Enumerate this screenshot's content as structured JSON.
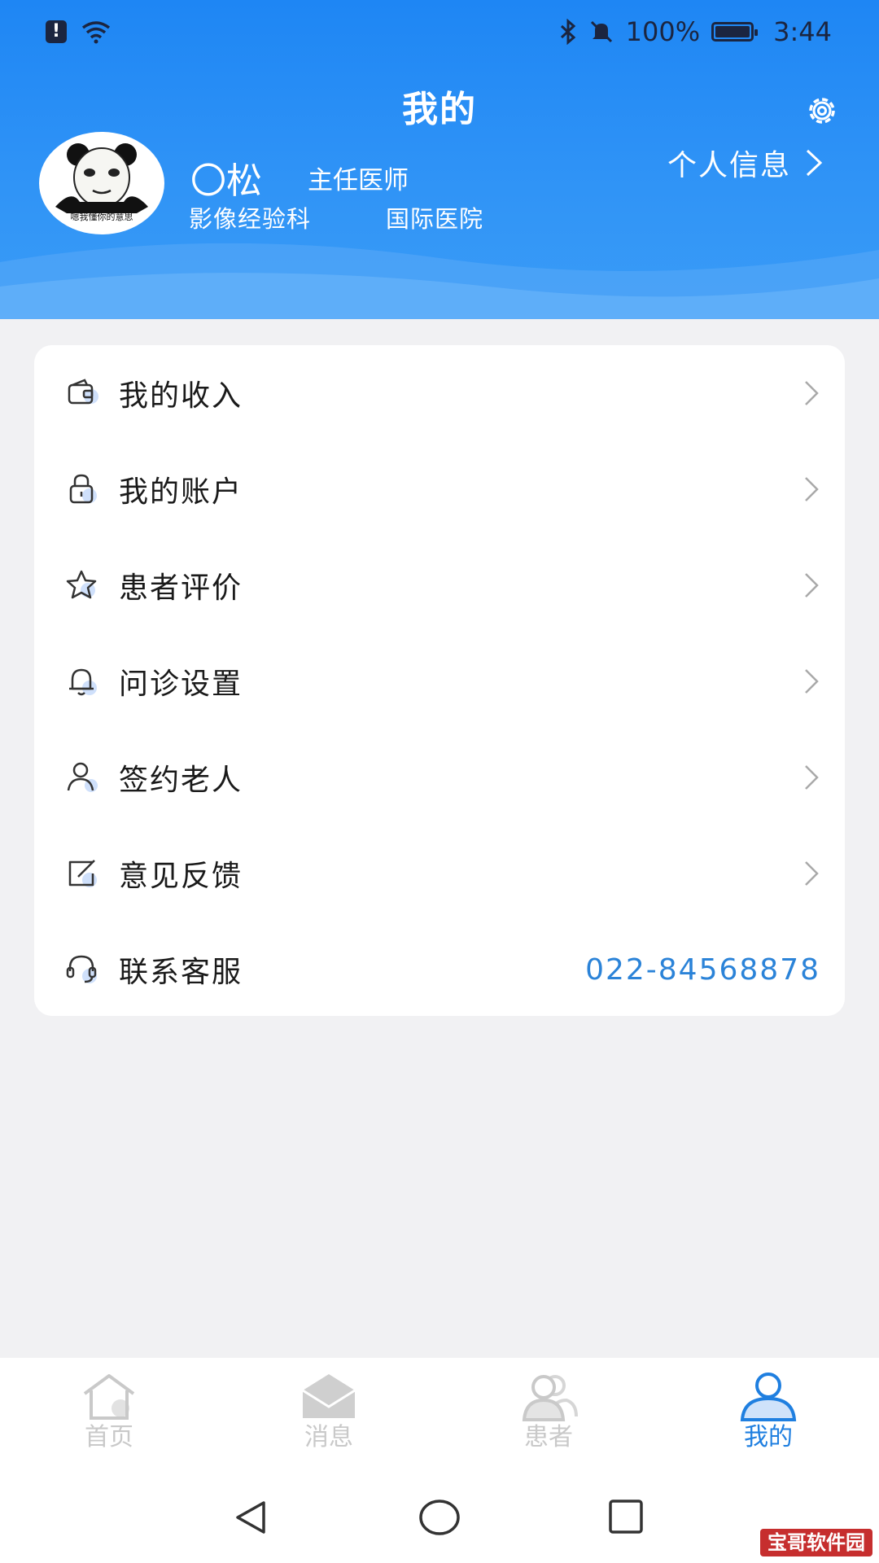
{
  "status_bar": {
    "battery": "100%",
    "time": "3:44"
  },
  "header": {
    "title": "我的",
    "user": {
      "name": "〇松",
      "title": "主任医师",
      "department": "影像经验科",
      "hospital": "国际医院",
      "avatar_caption": "嗯我懂你的意思"
    },
    "profile_link": "个人信息"
  },
  "menu": {
    "items": [
      {
        "icon": "wallet-icon",
        "label": "我的收入"
      },
      {
        "icon": "lock-icon",
        "label": "我的账户"
      },
      {
        "icon": "star-icon",
        "label": "患者评价"
      },
      {
        "icon": "bell-icon",
        "label": "问诊设置"
      },
      {
        "icon": "person-icon",
        "label": "签约老人"
      },
      {
        "icon": "edit-icon",
        "label": "意见反馈"
      },
      {
        "icon": "headset-icon",
        "label": "联系客服",
        "value": "022-84568878"
      }
    ]
  },
  "tabs": [
    {
      "label": "首页",
      "icon": "home-icon",
      "active": false
    },
    {
      "label": "消息",
      "icon": "mail-icon",
      "active": false
    },
    {
      "label": "患者",
      "icon": "patients-icon",
      "active": false
    },
    {
      "label": "我的",
      "icon": "profile-icon",
      "active": true
    }
  ],
  "watermark": "宝哥软件园",
  "colors": {
    "accent": "#1e86f4",
    "active_tab": "#1f7fe0",
    "inactive_tab": "#c9c9c9",
    "phone": "#2b83d8"
  }
}
